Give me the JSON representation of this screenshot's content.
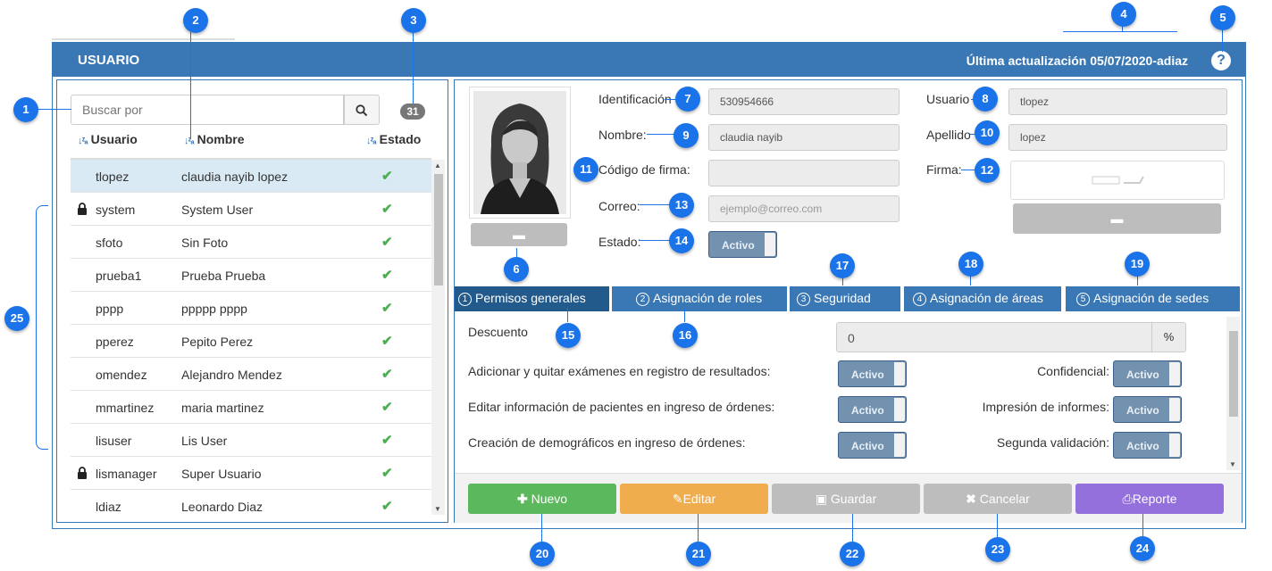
{
  "header": {
    "title": "USUARIO",
    "updated": "Última actualización 05/07/2020-adiaz",
    "help": "?"
  },
  "left": {
    "search_placeholder": "Buscar por",
    "count": "31",
    "columns": {
      "user": "Usuario",
      "name": "Nombre",
      "status": "Estado"
    },
    "rows": [
      {
        "user": "tlopez",
        "name": "claudia nayib lopez",
        "locked": false,
        "selected": true
      },
      {
        "user": "system",
        "name": "System User",
        "locked": true,
        "selected": false
      },
      {
        "user": "sfoto",
        "name": "Sin Foto",
        "locked": false,
        "selected": false
      },
      {
        "user": "prueba1",
        "name": "Prueba Prueba",
        "locked": false,
        "selected": false
      },
      {
        "user": "pppp",
        "name": "ppppp pppp",
        "locked": false,
        "selected": false
      },
      {
        "user": "pperez",
        "name": "Pepito Perez",
        "locked": false,
        "selected": false
      },
      {
        "user": "omendez",
        "name": "Alejandro Mendez",
        "locked": false,
        "selected": false
      },
      {
        "user": "mmartinez",
        "name": "maria martinez",
        "locked": false,
        "selected": false
      },
      {
        "user": "lisuser",
        "name": "Lis User",
        "locked": false,
        "selected": false
      },
      {
        "user": "lismanager",
        "name": "Super Usuario",
        "locked": true,
        "selected": false
      },
      {
        "user": "ldiaz",
        "name": "Leonardo Diaz",
        "locked": false,
        "selected": false
      }
    ]
  },
  "form": {
    "id_label": "Identificación",
    "id_value": "530954666",
    "user_label": "Usuario",
    "user_value": "tlopez",
    "name_label": "Nombre:",
    "name_value": "claudia nayib",
    "lastname_label": "Apellido",
    "lastname_value": "lopez",
    "sigcode_label": "Código de firma:",
    "sigcode_value": "",
    "signature_label": "Firma:",
    "email_label": "Correo:",
    "email_placeholder": "ejemplo@correo.com",
    "status_label": "Estado:",
    "status_value": "Activo"
  },
  "tabs": [
    {
      "num": "1",
      "label": "Permisos generales"
    },
    {
      "num": "2",
      "label": "Asignación de roles"
    },
    {
      "num": "3",
      "label": "Seguridad"
    },
    {
      "num": "4",
      "label": "Asignación de áreas"
    },
    {
      "num": "5",
      "label": "Asignación de sedes"
    }
  ],
  "permissions": {
    "discount_label": "Descuento",
    "discount_value": "0",
    "discount_unit": "%",
    "left": [
      {
        "label": "Adicionar y quitar exámenes en registro de resultados:",
        "value": "Activo"
      },
      {
        "label": "Editar información de pacientes en ingreso de órdenes:",
        "value": "Activo"
      },
      {
        "label": "Creación de demográficos en ingreso de órdenes:",
        "value": "Activo"
      }
    ],
    "right": [
      {
        "label": "Confidencial:",
        "value": "Activo"
      },
      {
        "label": "Impresión de informes:",
        "value": "Activo"
      },
      {
        "label": "Segunda validación:",
        "value": "Activo"
      }
    ]
  },
  "footer": {
    "new": "Nuevo",
    "edit": "Editar",
    "save": "Guardar",
    "cancel": "Cancelar",
    "report": "Reporte"
  },
  "callouts": [
    "1",
    "2",
    "3",
    "4",
    "5",
    "6",
    "7",
    "8",
    "9",
    "10",
    "11",
    "12",
    "13",
    "14",
    "15",
    "16",
    "17",
    "18",
    "19",
    "20",
    "21",
    "22",
    "23",
    "24",
    "25"
  ],
  "colors": {
    "primary": "#3a78b5",
    "success": "#5cb85c",
    "warning": "#f0ad4e",
    "disabled": "#bdbdbd",
    "report": "#9370db",
    "callout": "#1a73e8"
  }
}
